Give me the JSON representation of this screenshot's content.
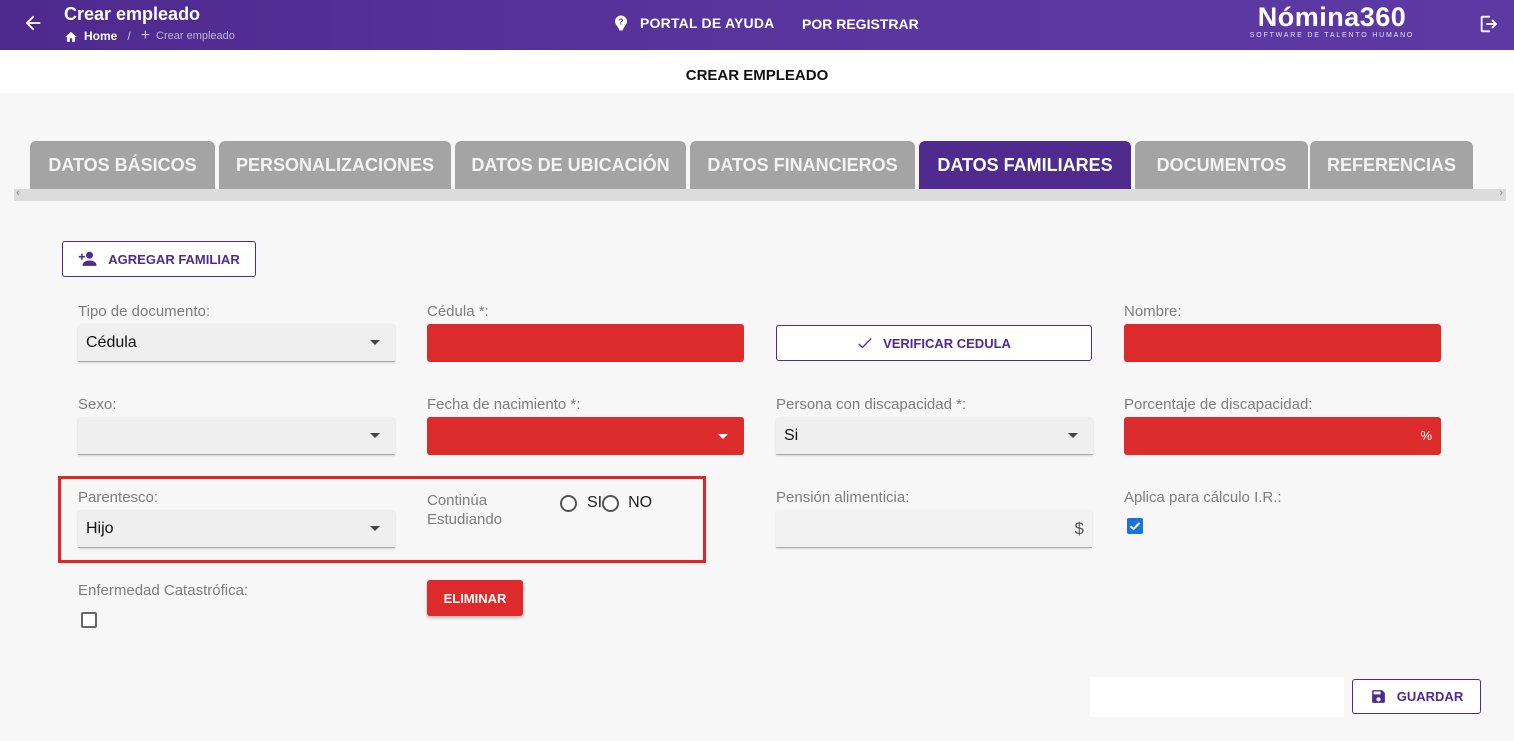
{
  "topbar": {
    "title": "Crear empleado",
    "breadcrumb_home": "Home",
    "breadcrumb_sep": "/",
    "breadcrumb_current": "Crear empleado",
    "help_label": "PORTAL DE AYUDA",
    "register_label": "POR REGISTRAR",
    "logo_main": "Nómina360",
    "logo_sub": "SOFTWARE DE TALENTO HUMANO",
    "icons": [
      "arrow-back-icon",
      "home-icon",
      "plus-icon",
      "help-icon",
      "logout-icon"
    ]
  },
  "page": {
    "title": "CREAR EMPLEADO"
  },
  "tabs": [
    {
      "label": "DATOS BÁSICOS",
      "active": false
    },
    {
      "label": "PERSONALIZACIONES",
      "active": false
    },
    {
      "label": "DATOS DE UBICACIÓN",
      "active": false
    },
    {
      "label": "DATOS FINANCIEROS",
      "active": false
    },
    {
      "label": "DATOS FAMILIARES",
      "active": true
    },
    {
      "label": "DOCUMENTOS",
      "active": false
    },
    {
      "label": "REFERENCIAS",
      "active": false
    }
  ],
  "actions": {
    "add_family": "AGREGAR FAMILIAR",
    "verify_cedula": "VERIFICAR CEDULA",
    "delete": "ELIMINAR",
    "save": "GUARDAR"
  },
  "form": {
    "tipo_documento": {
      "label": "Tipo de documento:",
      "value": "Cédula"
    },
    "cedula": {
      "label": "Cédula *:",
      "value": ""
    },
    "nombre": {
      "label": "Nombre:",
      "value": ""
    },
    "sexo": {
      "label": "Sexo:",
      "value": ""
    },
    "fecha_nacimiento": {
      "label": "Fecha de nacimiento *:",
      "value": ""
    },
    "discapacidad": {
      "label": "Persona con discapacidad *:",
      "value": "Si"
    },
    "porcentaje_discapacidad": {
      "label": "Porcentaje de discapacidad:",
      "value": "",
      "suffix": "%"
    },
    "parentesco": {
      "label": "Parentesco:",
      "value": "Hijo"
    },
    "continua_estudiando": {
      "label_line1": "Continúa",
      "label_line2": "Estudiando",
      "option_yes": "SI",
      "option_no": "NO",
      "selected": ""
    },
    "pension_alimenticia": {
      "label": "Pensión alimenticia:",
      "value": "",
      "suffix": "$"
    },
    "aplica_ir": {
      "label": "Aplica para cálculo I.R.:",
      "checked": true
    },
    "enfermedad_catastrofica": {
      "label": "Enfermedad Catastrófica:",
      "checked": false
    }
  },
  "colors": {
    "primary": "#4f2b8f",
    "danger": "#dc2b2b",
    "tab_inactive": "#a4a4a4",
    "highlight": "#e0262a",
    "checkbox": "#1a73d8"
  }
}
